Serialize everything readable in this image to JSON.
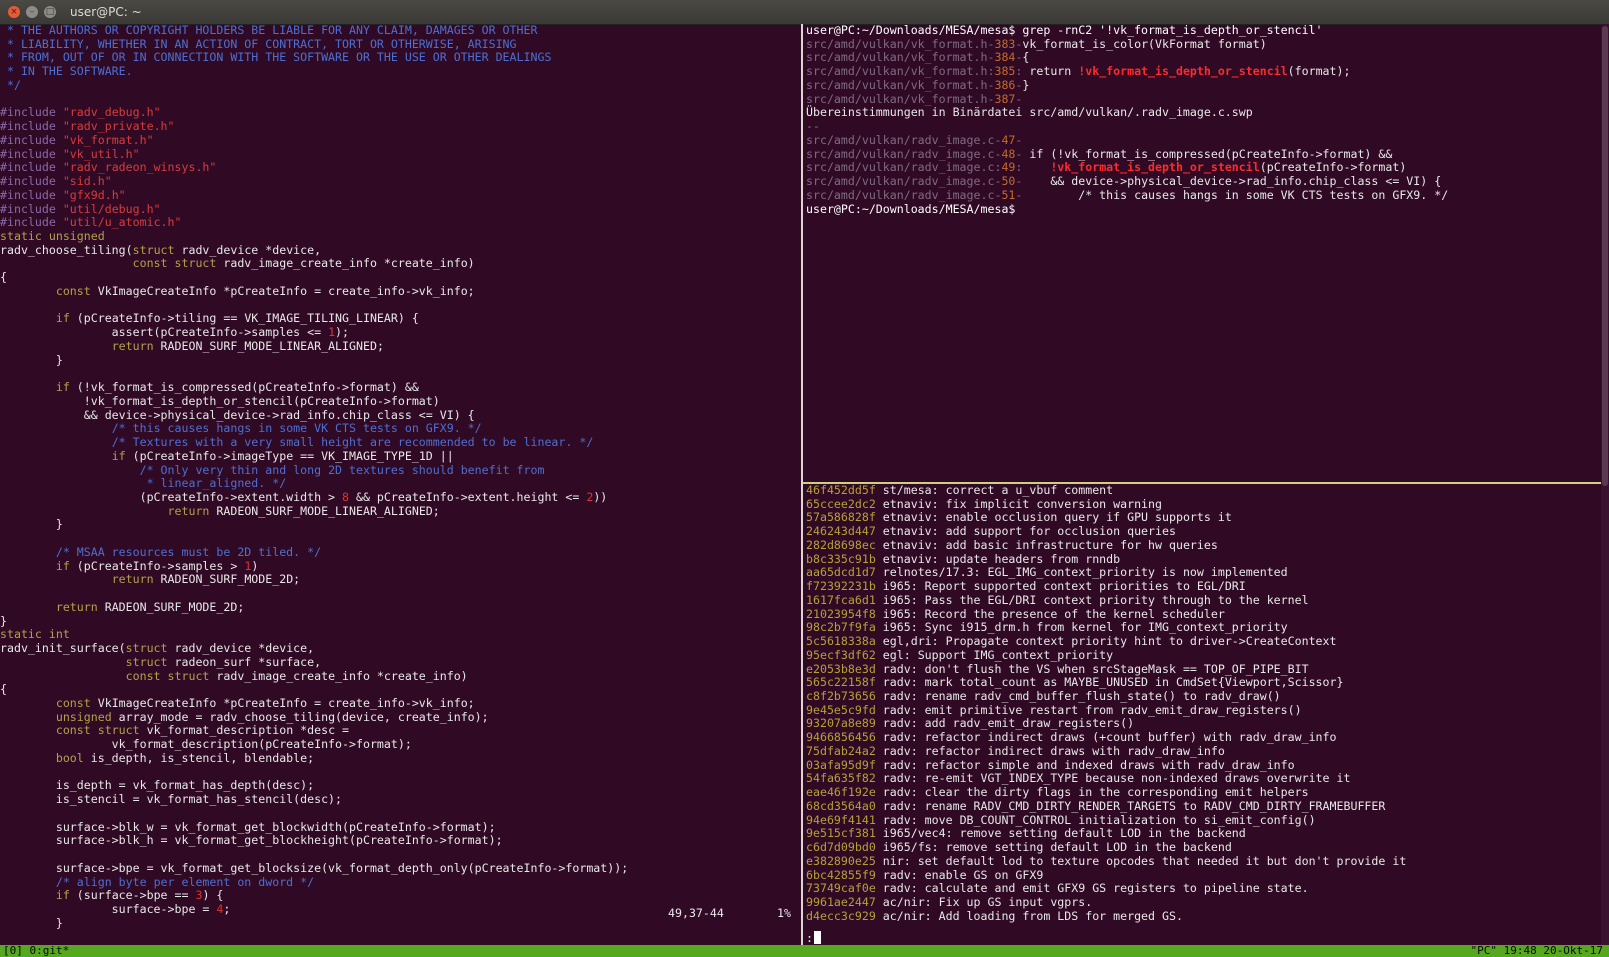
{
  "window": {
    "title": "user@PC: ~",
    "buttons": {
      "close": "×",
      "minimize": "–",
      "maximize": "□"
    }
  },
  "editor": {
    "lines": [
      [
        {
          "c": "cm",
          "t": " * THE AUTHORS OR COPYRIGHT HOLDERS BE LIABLE FOR ANY CLAIM, DAMAGES OR OTHER"
        }
      ],
      [
        {
          "c": "cm",
          "t": " * LIABILITY, WHETHER IN AN ACTION OF CONTRACT, TORT OR OTHERWISE, ARISING"
        }
      ],
      [
        {
          "c": "cm",
          "t": " * FROM, OUT OF OR IN CONNECTION WITH THE SOFTWARE OR THE USE OR OTHER DEALINGS"
        }
      ],
      [
        {
          "c": "cm",
          "t": " * IN THE SOFTWARE."
        }
      ],
      [
        {
          "c": "cm",
          "t": " */"
        }
      ],
      [],
      [
        {
          "c": "pp",
          "t": "#include "
        },
        {
          "c": "str",
          "t": "\"radv_debug.h\""
        }
      ],
      [
        {
          "c": "pp",
          "t": "#include "
        },
        {
          "c": "str",
          "t": "\"radv_private.h\""
        }
      ],
      [
        {
          "c": "pp",
          "t": "#include "
        },
        {
          "c": "str",
          "t": "\"vk_format.h\""
        }
      ],
      [
        {
          "c": "pp",
          "t": "#include "
        },
        {
          "c": "str",
          "t": "\"vk_util.h\""
        }
      ],
      [
        {
          "c": "pp",
          "t": "#include "
        },
        {
          "c": "str",
          "t": "\"radv_radeon_winsys.h\""
        }
      ],
      [
        {
          "c": "pp",
          "t": "#include "
        },
        {
          "c": "str",
          "t": "\"sid.h\""
        }
      ],
      [
        {
          "c": "pp",
          "t": "#include "
        },
        {
          "c": "str",
          "t": "\"gfx9d.h\""
        }
      ],
      [
        {
          "c": "pp",
          "t": "#include "
        },
        {
          "c": "str",
          "t": "\"util/debug.h\""
        }
      ],
      [
        {
          "c": "pp",
          "t": "#include "
        },
        {
          "c": "str",
          "t": "\"util/u_atomic.h\""
        }
      ],
      [
        {
          "c": "kw",
          "t": "static unsigned"
        }
      ],
      [
        {
          "c": "",
          "t": "radv_choose_tiling("
        },
        {
          "c": "kw",
          "t": "struct"
        },
        {
          "c": "",
          "t": " radv_device *device,"
        }
      ],
      [
        {
          "c": "",
          "t": "                   "
        },
        {
          "c": "kw",
          "t": "const struct"
        },
        {
          "c": "",
          "t": " radv_image_create_info *create_info)"
        }
      ],
      [
        {
          "c": "",
          "t": "{"
        }
      ],
      [
        {
          "c": "",
          "t": "        "
        },
        {
          "c": "kw",
          "t": "const"
        },
        {
          "c": "",
          "t": " VkImageCreateInfo *pCreateInfo = create_info->vk_info;"
        }
      ],
      [],
      [
        {
          "c": "",
          "t": "        "
        },
        {
          "c": "kw",
          "t": "if"
        },
        {
          "c": "",
          "t": " (pCreateInfo->tiling == VK_IMAGE_TILING_LINEAR) {"
        }
      ],
      [
        {
          "c": "",
          "t": "                assert(pCreateInfo->samples <= "
        },
        {
          "c": "num",
          "t": "1"
        },
        {
          "c": "",
          "t": ");"
        }
      ],
      [
        {
          "c": "",
          "t": "                "
        },
        {
          "c": "kw",
          "t": "return"
        },
        {
          "c": "",
          "t": " RADEON_SURF_MODE_LINEAR_ALIGNED;"
        }
      ],
      [
        {
          "c": "",
          "t": "        }"
        }
      ],
      [],
      [
        {
          "c": "",
          "t": "        "
        },
        {
          "c": "kw",
          "t": "if"
        },
        {
          "c": "",
          "t": " (!vk_format_is_compressed(pCreateInfo->format) &&"
        }
      ],
      [
        {
          "c": "",
          "t": "            !vk_format_is_depth_or_stencil(pCreateInfo->format)"
        }
      ],
      [
        {
          "c": "",
          "t": "            && device->physical_device->rad_info.chip_class <= VI) {"
        }
      ],
      [
        {
          "c": "",
          "t": "                "
        },
        {
          "c": "cm",
          "t": "/* this causes hangs in some VK CTS tests on GFX9. */"
        }
      ],
      [
        {
          "c": "",
          "t": "                "
        },
        {
          "c": "cm",
          "t": "/* Textures with a very small height are recommended to be linear. */"
        }
      ],
      [
        {
          "c": "",
          "t": "                "
        },
        {
          "c": "kw",
          "t": "if"
        },
        {
          "c": "",
          "t": " (pCreateInfo->imageType == VK_IMAGE_TYPE_1D ||"
        }
      ],
      [
        {
          "c": "",
          "t": "                    "
        },
        {
          "c": "cm",
          "t": "/* Only very thin and long 2D textures should benefit from"
        }
      ],
      [
        {
          "c": "cm",
          "t": "                     * linear_aligned. */"
        }
      ],
      [
        {
          "c": "",
          "t": "                    (pCreateInfo->extent.width > "
        },
        {
          "c": "num",
          "t": "8"
        },
        {
          "c": "",
          "t": " && pCreateInfo->extent.height <= "
        },
        {
          "c": "num",
          "t": "2"
        },
        {
          "c": "",
          "t": "))"
        }
      ],
      [
        {
          "c": "",
          "t": "                        "
        },
        {
          "c": "kw",
          "t": "return"
        },
        {
          "c": "",
          "t": " RADEON_SURF_MODE_LINEAR_ALIGNED;"
        }
      ],
      [
        {
          "c": "",
          "t": "        }"
        }
      ],
      [],
      [
        {
          "c": "",
          "t": "        "
        },
        {
          "c": "cm",
          "t": "/* MSAA resources must be 2D tiled. */"
        }
      ],
      [
        {
          "c": "",
          "t": "        "
        },
        {
          "c": "kw",
          "t": "if"
        },
        {
          "c": "",
          "t": " (pCreateInfo->samples > "
        },
        {
          "c": "num",
          "t": "1"
        },
        {
          "c": "",
          "t": ")"
        }
      ],
      [
        {
          "c": "",
          "t": "                "
        },
        {
          "c": "kw",
          "t": "return"
        },
        {
          "c": "",
          "t": " RADEON_SURF_MODE_2D;"
        }
      ],
      [],
      [
        {
          "c": "",
          "t": "        "
        },
        {
          "c": "kw",
          "t": "return"
        },
        {
          "c": "",
          "t": " RADEON_SURF_MODE_2D;"
        }
      ],
      [
        {
          "c": "",
          "t": "}"
        }
      ],
      [
        {
          "c": "kw",
          "t": "static int"
        }
      ],
      [
        {
          "c": "",
          "t": "radv_init_surface("
        },
        {
          "c": "kw",
          "t": "struct"
        },
        {
          "c": "",
          "t": " radv_device *device,"
        }
      ],
      [
        {
          "c": "",
          "t": "                  "
        },
        {
          "c": "kw",
          "t": "struct"
        },
        {
          "c": "",
          "t": " radeon_surf *surface,"
        }
      ],
      [
        {
          "c": "",
          "t": "                  "
        },
        {
          "c": "kw",
          "t": "const struct"
        },
        {
          "c": "",
          "t": " radv_image_create_info *create_info)"
        }
      ],
      [
        {
          "c": "",
          "t": "{"
        }
      ],
      [
        {
          "c": "",
          "t": "        "
        },
        {
          "c": "kw",
          "t": "const"
        },
        {
          "c": "",
          "t": " VkImageCreateInfo *pCreateInfo = create_info->vk_info;"
        }
      ],
      [
        {
          "c": "",
          "t": "        "
        },
        {
          "c": "kw",
          "t": "unsigned"
        },
        {
          "c": "",
          "t": " array_mode = radv_choose_tiling(device, create_info);"
        }
      ],
      [
        {
          "c": "",
          "t": "        "
        },
        {
          "c": "kw",
          "t": "const struct"
        },
        {
          "c": "",
          "t": " vk_format_description *desc ="
        }
      ],
      [
        {
          "c": "",
          "t": "                vk_format_description(pCreateInfo->format);"
        }
      ],
      [
        {
          "c": "",
          "t": "        "
        },
        {
          "c": "kw",
          "t": "bool"
        },
        {
          "c": "",
          "t": " is_depth, is_stencil, blendable;"
        }
      ],
      [],
      [
        {
          "c": "",
          "t": "        is_depth = vk_format_has_depth(desc);"
        }
      ],
      [
        {
          "c": "",
          "t": "        is_stencil = vk_format_has_stencil(desc);"
        }
      ],
      [],
      [
        {
          "c": "",
          "t": "        surface->blk_w = vk_format_get_blockwidth(pCreateInfo->format);"
        }
      ],
      [
        {
          "c": "",
          "t": "        surface->blk_h = vk_format_get_blockheight(pCreateInfo->format);"
        }
      ],
      [],
      [
        {
          "c": "",
          "t": "        surface->bpe = vk_format_get_blocksize(vk_format_depth_only(pCreateInfo->format));"
        }
      ],
      [
        {
          "c": "",
          "t": "        "
        },
        {
          "c": "cm",
          "t": "/* align byte per element on dword */"
        }
      ],
      [
        {
          "c": "",
          "t": "        "
        },
        {
          "c": "kw",
          "t": "if"
        },
        {
          "c": "",
          "t": " (surface->bpe == "
        },
        {
          "c": "num",
          "t": "3"
        },
        {
          "c": "",
          "t": ") {"
        }
      ],
      [
        {
          "c": "",
          "t": "                surface->bpe = "
        },
        {
          "c": "num",
          "t": "4"
        },
        {
          "c": "",
          "t": ";"
        }
      ],
      [
        {
          "c": "",
          "t": "        }"
        }
      ]
    ],
    "cursor_pos": "49,37-44",
    "percent": "1%"
  },
  "grep": {
    "lines": [
      [
        {
          "c": "prompt",
          "t": "user@PC:~/Downloads/MESA/mesa$ grep -rnC2 '!vk_format_is_depth_or_stencil'"
        }
      ],
      [
        {
          "c": "path",
          "t": "src/amd/vulkan/vk_format.h"
        },
        {
          "c": "sep",
          "t": "-"
        },
        {
          "c": "lnum",
          "t": "383"
        },
        {
          "c": "sep",
          "t": "-"
        },
        {
          "c": "",
          "t": "vk_format_is_color(VkFormat format)"
        }
      ],
      [
        {
          "c": "path",
          "t": "src/amd/vulkan/vk_format.h"
        },
        {
          "c": "sep",
          "t": "-"
        },
        {
          "c": "lnum",
          "t": "384"
        },
        {
          "c": "sep",
          "t": "-"
        },
        {
          "c": "",
          "t": "{"
        }
      ],
      [
        {
          "c": "path",
          "t": "src/amd/vulkan/vk_format.h"
        },
        {
          "c": "sep",
          "t": ":"
        },
        {
          "c": "lnum",
          "t": "385"
        },
        {
          "c": "sep",
          "t": ":"
        },
        {
          "c": "",
          "t": " return "
        },
        {
          "c": "hl",
          "t": "!vk_format_is_depth_or_stencil"
        },
        {
          "c": "",
          "t": "(format);"
        }
      ],
      [
        {
          "c": "path",
          "t": "src/amd/vulkan/vk_format.h"
        },
        {
          "c": "sep",
          "t": "-"
        },
        {
          "c": "lnum",
          "t": "386"
        },
        {
          "c": "sep",
          "t": "-"
        },
        {
          "c": "",
          "t": "}"
        }
      ],
      [
        {
          "c": "path",
          "t": "src/amd/vulkan/vk_format.h"
        },
        {
          "c": "sep",
          "t": "-"
        },
        {
          "c": "lnum",
          "t": "387"
        },
        {
          "c": "sep",
          "t": "-"
        }
      ],
      [
        {
          "c": "",
          "t": "Übereinstimmungen in Binärdatei src/amd/vulkan/.radv_image.c.swp"
        }
      ],
      [
        {
          "c": "sep",
          "t": "--"
        }
      ],
      [
        {
          "c": "path",
          "t": "src/amd/vulkan/radv_image.c"
        },
        {
          "c": "sep",
          "t": "-"
        },
        {
          "c": "lnum",
          "t": "47"
        },
        {
          "c": "sep",
          "t": "-"
        }
      ],
      [
        {
          "c": "path",
          "t": "src/amd/vulkan/radv_image.c"
        },
        {
          "c": "sep",
          "t": "-"
        },
        {
          "c": "lnum",
          "t": "48"
        },
        {
          "c": "sep",
          "t": "-"
        },
        {
          "c": "",
          "t": " if (!vk_format_is_compressed(pCreateInfo->format) &&"
        }
      ],
      [
        {
          "c": "path",
          "t": "src/amd/vulkan/radv_image.c"
        },
        {
          "c": "sep",
          "t": ":"
        },
        {
          "c": "lnum",
          "t": "49"
        },
        {
          "c": "sep",
          "t": ":"
        },
        {
          "c": "",
          "t": "    "
        },
        {
          "c": "hl",
          "t": "!vk_format_is_depth_or_stencil"
        },
        {
          "c": "",
          "t": "(pCreateInfo->format)"
        }
      ],
      [
        {
          "c": "path",
          "t": "src/amd/vulkan/radv_image.c"
        },
        {
          "c": "sep",
          "t": "-"
        },
        {
          "c": "lnum",
          "t": "50"
        },
        {
          "c": "sep",
          "t": "-"
        },
        {
          "c": "",
          "t": "    && device->physical_device->rad_info.chip_class <= VI) {"
        }
      ],
      [
        {
          "c": "path",
          "t": "src/amd/vulkan/radv_image.c"
        },
        {
          "c": "sep",
          "t": "-"
        },
        {
          "c": "lnum",
          "t": "51"
        },
        {
          "c": "sep",
          "t": "-"
        },
        {
          "c": "",
          "t": "        /* this causes hangs in some VK CTS tests on GFX9. */"
        }
      ],
      [
        {
          "c": "prompt",
          "t": "user@PC:~/Downloads/MESA/mesa$"
        }
      ]
    ]
  },
  "gitlog": {
    "commits": [
      {
        "hash": "46f452dd5f",
        "msg": "st/mesa: correct a u_vbuf comment"
      },
      {
        "hash": "65cceе2dc2",
        "msg": "etnaviv: fix implicit conversion warning"
      },
      {
        "hash": "57a586828f",
        "msg": "etnaviv: enable occlusion query if GPU supports it"
      },
      {
        "hash": "246243d447",
        "msg": "etnaviv: add support for occlusion queries"
      },
      {
        "hash": "282d8698ec",
        "msg": "etnaviv: add basic infrastructure for hw queries"
      },
      {
        "hash": "b8c335c91b",
        "msg": "etnaviv: update headers from rnndb"
      },
      {
        "hash": "aa65dcd1d7",
        "msg": "relnotes/17.3: EGL_IMG_context_priority is now implemented"
      },
      {
        "hash": "f72392231b",
        "msg": "i965: Report supported context priorities to EGL/DRI"
      },
      {
        "hash": "1617fca6d1",
        "msg": "i965: Pass the EGL/DRI context priority through to the kernel"
      },
      {
        "hash": "21023954f8",
        "msg": "i965: Record the presence of the kernel scheduler"
      },
      {
        "hash": "98c2b7f9fa",
        "msg": "i965: Sync i915_drm.h from kernel for IMG_context_priority"
      },
      {
        "hash": "5c5618338a",
        "msg": "egl,dri: Propagate context priority hint to driver->CreateContext"
      },
      {
        "hash": "95ecf3df62",
        "msg": "egl: Support IMG_context_priority"
      },
      {
        "hash": "e2053b8e3d",
        "msg": "radv: don't flush the VS when srcStageMask == TOP_OF_PIPE_BIT"
      },
      {
        "hash": "565c22158f",
        "msg": "radv: mark total_count as MAYBE_UNUSED in CmdSet{Viewport,Scissor}"
      },
      {
        "hash": "c8f2b73656",
        "msg": "radv: rename radv_cmd_buffer_flush_state() to radv_draw()"
      },
      {
        "hash": "9e45e5c9fd",
        "msg": "radv: emit primitive restart from radv_emit_draw_registers()"
      },
      {
        "hash": "93207a8e89",
        "msg": "radv: add radv_emit_draw_registers()"
      },
      {
        "hash": "9466856456",
        "msg": "radv: refactor indirect draws (+count buffer) with radv_draw_info"
      },
      {
        "hash": "75dfab24a2",
        "msg": "radv: refactor indirect draws with radv_draw_info"
      },
      {
        "hash": "03afa95d9f",
        "msg": "radv: refactor simple and indexed draws with radv_draw_info"
      },
      {
        "hash": "54fa635f82",
        "msg": "radv: re-emit VGT_INDEX_TYPE because non-indexed draws overwrite it"
      },
      {
        "hash": "eae46f192e",
        "msg": "radv: clear the dirty flags in the corresponding emit helpers"
      },
      {
        "hash": "68cd3564a0",
        "msg": "radv: rename RADV_CMD_DIRTY_RENDER_TARGETS to RADV_CMD_DIRTY_FRAMEBUFFER"
      },
      {
        "hash": "94e69f4141",
        "msg": "radv: move DB_COUNT_CONTROL initialization to si_emit_config()"
      },
      {
        "hash": "9e515cf381",
        "msg": "i965/vec4: remove setting default LOD in the backend"
      },
      {
        "hash": "c6d7d09bd0",
        "msg": "i965/fs: remove setting default LOD in the backend"
      },
      {
        "hash": "e382890e25",
        "msg": "nir: set default lod to texture opcodes that needed it but don't provide it"
      },
      {
        "hash": "6bc42855f9",
        "msg": "radv: enable GS on GFX9"
      },
      {
        "hash": "73749caf0e",
        "msg": "radv: calculate and emit GFX9 GS registers to pipeline state."
      },
      {
        "hash": "9961ae2447",
        "msg": "ac/nir: Fix up GS input vgprs."
      },
      {
        "hash": "d4ecc3c929",
        "msg": "ac/nir: Add loading from LDS for merged GS."
      }
    ],
    "prompt": ":"
  },
  "tmux": {
    "left": "[0] 0:git*",
    "right": "\"PC\" 19:48 20-Okt-17"
  }
}
